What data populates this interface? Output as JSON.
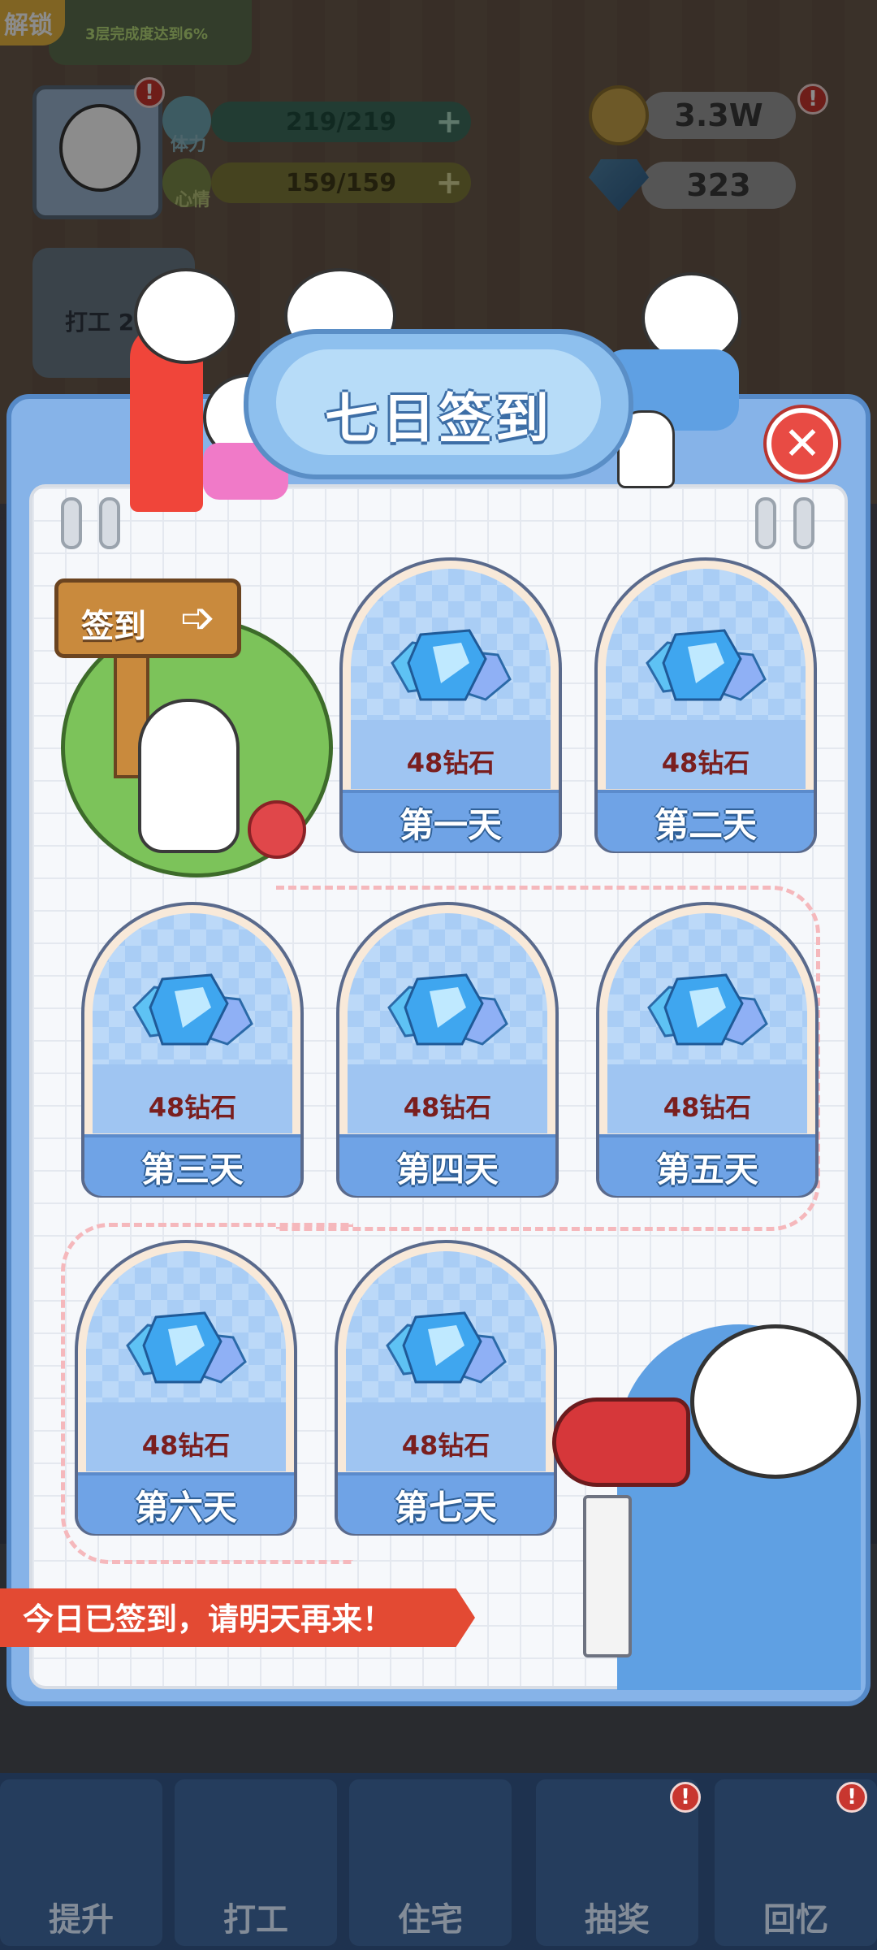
{
  "hud": {
    "unlock_label": "解锁",
    "quest_text": "3层完成度达到6%",
    "stamina_label": "体力",
    "stamina_value": "219/219",
    "mood_label": "心情",
    "mood_value": "159/159",
    "coins": "3.3W",
    "diamonds": "323",
    "work_label": "打工 2"
  },
  "modal": {
    "title": "七日签到",
    "signpost": "签到",
    "days": [
      {
        "amount": "48钻石",
        "label": "第一天"
      },
      {
        "amount": "48钻石",
        "label": "第二天"
      },
      {
        "amount": "48钻石",
        "label": "第三天"
      },
      {
        "amount": "48钻石",
        "label": "第四天"
      },
      {
        "amount": "48钻石",
        "label": "第五天"
      },
      {
        "amount": "48钻石",
        "label": "第六天"
      },
      {
        "amount": "48钻石",
        "label": "第七天"
      }
    ],
    "status_banner": "今日已签到，请明天再来！"
  },
  "nav": {
    "items": [
      "提升",
      "打工",
      "住宅",
      "抽奖",
      "回忆"
    ]
  },
  "colors": {
    "modal_bg": "#86b3e8",
    "close_button": "#e84b44",
    "banner": "#e34a33",
    "amount_text": "#7a1f1f"
  }
}
